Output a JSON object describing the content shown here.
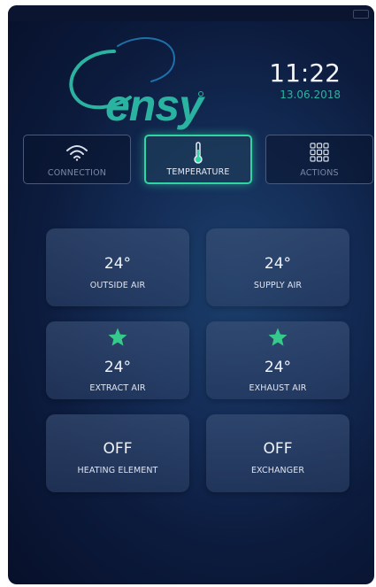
{
  "colors": {
    "accent": "#2fd6a4",
    "brand": "#2ab3a0",
    "background": "#0c1b3d",
    "tile": "#3a5074"
  },
  "brand": {
    "name": "ensy"
  },
  "clock": {
    "time": "11:22",
    "date": "13.06.2018"
  },
  "tabs": [
    {
      "label": "CONNECTION",
      "icon": "wifi-icon",
      "active": false
    },
    {
      "label": "TEMPERATURE",
      "icon": "thermometer-icon",
      "active": true
    },
    {
      "label": "ACTIONS",
      "icon": "grid-icon",
      "active": false
    }
  ],
  "tiles": [
    {
      "value": "24°",
      "label": "OUTSIDE AIR",
      "star": false
    },
    {
      "value": "24°",
      "label": "SUPPLY AIR",
      "star": false
    },
    {
      "value": "24°",
      "label": "EXTRACT AIR",
      "star": true
    },
    {
      "value": "24°",
      "label": "EXHAUST AIR",
      "star": true
    },
    {
      "value": "OFF",
      "label": "HEATING ELEMENT",
      "star": false
    },
    {
      "value": "OFF",
      "label": "EXCHANGER",
      "star": false
    }
  ]
}
